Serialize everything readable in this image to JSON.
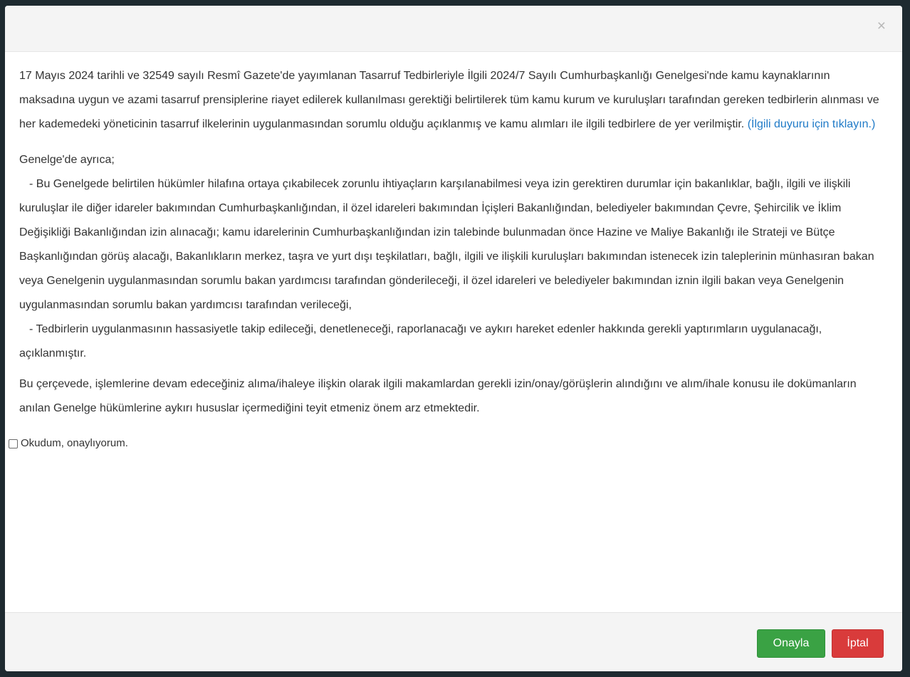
{
  "modal": {
    "close_symbol": "×",
    "body": {
      "p1_text": "17 Mayıs 2024 tarihli ve 32549 sayılı Resmî Gazete'de yayımlanan Tasarruf Tedbirleriyle İlgili 2024/7 Sayılı Cumhurbaşkanlığı Genelgesi'nde kamu kaynaklarının maksadına uygun ve azami tasarruf prensiplerine riayet edilerek kullanılması gerektiği belirtilerek tüm kamu kurum ve kuruluşları tarafından gereken tedbirlerin alınması ve her kademedeki yöneticinin tasarruf ilkelerinin uygulanmasından sorumlu olduğu açıklanmış ve kamu alımları ile ilgili tedbirlere de yer verilmiştir.",
      "p1_link": "(İlgili duyuru için tıklayın.)",
      "p2_intro": "Genelge'de ayrıca;",
      "p2_item1": "- Bu Genelgede belirtilen hükümler hilafına ortaya çıkabilecek zorunlu ihtiyaçların karşılanabilmesi veya izin gerektiren durumlar için bakanlıklar, bağlı, ilgili ve ilişkili kuruluşlar ile diğer idareler bakımından Cumhurbaşkanlığından, il özel idareleri bakımından İçişleri Bakanlığından, belediyeler bakımından Çevre, Şehircilik ve İklim Değişikliği Bakanlığından izin alınacağı; kamu idarelerinin Cumhurbaşkanlığından izin talebinde bulunmadan önce Hazine ve Maliye Bakanlığı ile Strateji ve Bütçe Başkanlığından görüş alacağı, Bakanlıkların merkez, taşra ve yurt dışı teşkilatları, bağlı, ilgili ve ilişkili kuruluşları bakımından istenecek izin taleplerinin münhasıran bakan veya Genelgenin uygulanmasından sorumlu bakan yardımcısı tarafından gönderileceği, il özel idareleri ve belediyeler bakımından iznin ilgili bakan veya Genelgenin uygulanmasından sorumlu bakan yardımcısı tarafından verileceği,",
      "p2_item2": "- Tedbirlerin uygulanmasının hassasiyetle takip edileceği, denetleneceği, raporlanacağı ve aykırı hareket edenler hakkında gerekli yaptırımların uygulanacağı, açıklanmıştır.",
      "p3_text": "Bu çerçevede, işlemlerine devam edeceğiniz alıma/ihaleye ilişkin olarak ilgili makamlardan gerekli izin/onay/görüşlerin alındığını ve alım/ihale konusu ile dokümanların anılan Genelge hükümlerine aykırı hususlar içermediğini teyit etmeniz önem arz etmektedir.",
      "checkbox_label": "Okudum, onaylıyorum.",
      "checkbox_checked": false
    },
    "footer": {
      "confirm_label": "Onayla",
      "cancel_label": "İptal"
    }
  },
  "colors": {
    "link": "#1f7ac7",
    "confirm": "#3aa244",
    "cancel": "#d93b3b"
  }
}
